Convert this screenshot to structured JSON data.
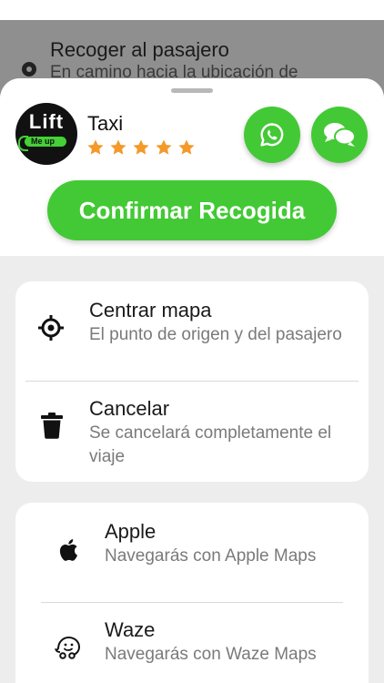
{
  "banner": {
    "title": "Recoger al pasajero",
    "subtitle": "En camino hacia la ubicación de"
  },
  "driver": {
    "logo_text": "Lift",
    "logo_sub": "Me up",
    "name": "Taxi",
    "rating": 5,
    "star_color": "#f39a2a"
  },
  "actions": {
    "whatsapp_icon": "whatsapp-icon",
    "chat_icon": "chat-icon",
    "confirm_label": "Confirmar Recogida",
    "accent_color": "#43c935"
  },
  "options": [
    {
      "icon": "crosshair-icon",
      "title": "Centrar mapa",
      "desc": "El punto de origen y del pasajero"
    },
    {
      "icon": "trash-icon",
      "title": "Cancelar",
      "desc": "Se cancelará completamente el viaje"
    }
  ],
  "navigation": [
    {
      "icon": "apple-icon",
      "title": "Apple",
      "desc": "Navegarás con Apple Maps"
    },
    {
      "icon": "waze-icon",
      "title": "Waze",
      "desc": "Navegarás con Waze Maps"
    }
  ]
}
